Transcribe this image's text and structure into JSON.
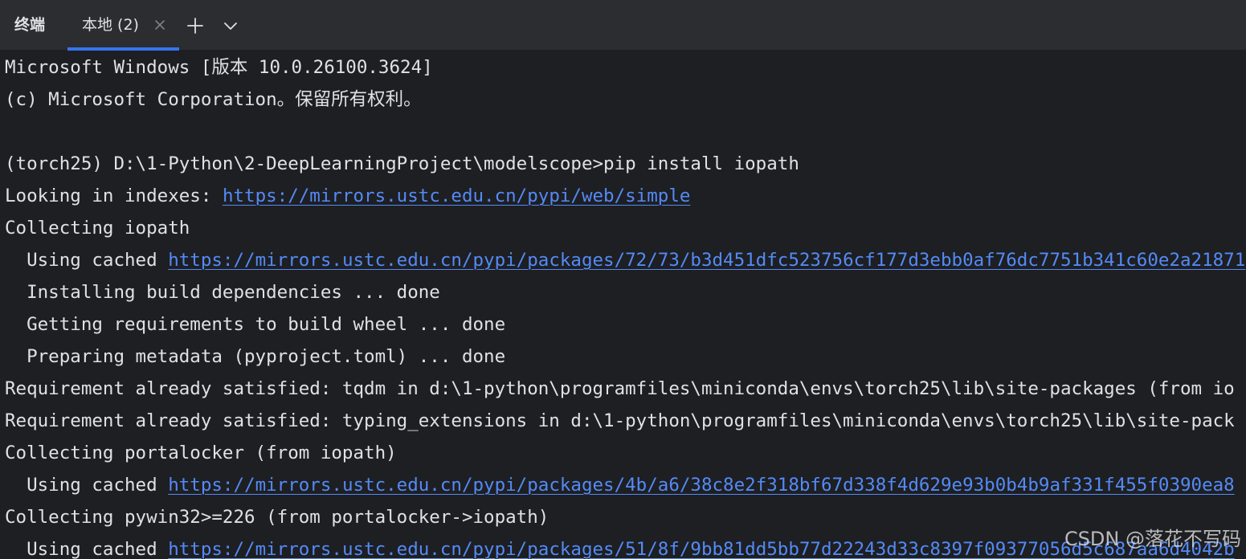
{
  "tabbar": {
    "panel_title": "终端",
    "active_tab_label": "本地 (2)"
  },
  "icons": {
    "close": "close-icon",
    "add": "plus-icon",
    "more": "chevron-down-icon"
  },
  "colors": {
    "background": "#1e1f22",
    "tabbar": "#2b2d30",
    "text": "#dfe1e5",
    "link": "#548af7",
    "accent": "#3574f0"
  },
  "terminal": {
    "lines": [
      {
        "text": "Microsoft Windows [版本 10.0.26100.3624]"
      },
      {
        "text": "(c) Microsoft Corporation。保留所有权利。"
      },
      {
        "text": ""
      },
      {
        "text": "(torch25) D:\\1-Python\\2-DeepLearningProject\\modelscope>pip install iopath"
      },
      {
        "prefix": "Looking in indexes: ",
        "link": "https://mirrors.ustc.edu.cn/pypi/web/simple"
      },
      {
        "text": "Collecting iopath"
      },
      {
        "prefix": "  Using cached ",
        "link": "https://mirrors.ustc.edu.cn/pypi/packages/72/73/b3d451dfc523756cf177d3ebb0af76dc7751b341c60e2a21871"
      },
      {
        "text": "  Installing build dependencies ... done"
      },
      {
        "text": "  Getting requirements to build wheel ... done"
      },
      {
        "text": "  Preparing metadata (pyproject.toml) ... done"
      },
      {
        "text": "Requirement already satisfied: tqdm in d:\\1-python\\programfiles\\miniconda\\envs\\torch25\\lib\\site-packages (from io"
      },
      {
        "text": "Requirement already satisfied: typing_extensions in d:\\1-python\\programfiles\\miniconda\\envs\\torch25\\lib\\site-pack"
      },
      {
        "text": "Collecting portalocker (from iopath)"
      },
      {
        "prefix": "  Using cached ",
        "link": "https://mirrors.ustc.edu.cn/pypi/packages/4b/a6/38c8e2f318bf67d338f4d629e93b0b4b9af331f455f0390ea8"
      },
      {
        "text": "Collecting pywin32>=226 (from portalocker->iopath)"
      },
      {
        "prefix": "  Using cached ",
        "link": "https://mirrors.ustc.edu.cn/pypi/packages/51/8f/9bb81dd5bb77d22243d33c8397f09377056d5c687aa6d4042b"
      }
    ]
  },
  "watermark": "CSDN @落花不写码"
}
